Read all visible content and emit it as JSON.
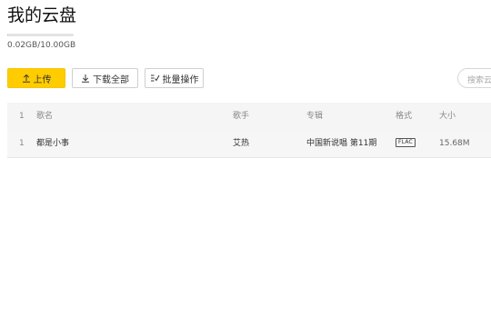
{
  "page": {
    "title": "我的云盘"
  },
  "storage": {
    "text": "0.02GB/10.00GB",
    "used_fraction": 0.002
  },
  "toolbar": {
    "upload_label": "上传",
    "download_all_label": "下载全部",
    "batch_label": "批量操作"
  },
  "search": {
    "placeholder": "搜索云盘"
  },
  "table": {
    "header": {
      "num": "1",
      "name": "歌名",
      "singer": "歌手",
      "album": "专辑",
      "format": "格式",
      "size": "大小"
    },
    "rows": [
      {
        "num": "1",
        "name": "都是小事",
        "singer": "艾热",
        "album": "中国新说唱 第11期",
        "format": "FLAC",
        "size": "15.68M"
      }
    ]
  },
  "colors": {
    "accent": "#ffcc00",
    "row_background": "#f6f6f6"
  },
  "icons": {
    "upload": "upload-icon",
    "download": "download-icon",
    "batch": "checklist-icon"
  }
}
